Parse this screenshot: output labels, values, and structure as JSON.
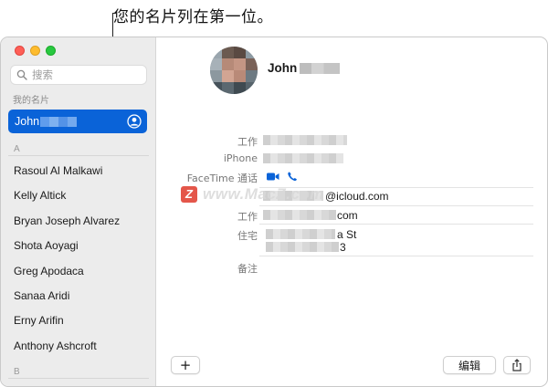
{
  "callout": {
    "text": "您的名片列在第一位。"
  },
  "window": {
    "traffic_lights": {
      "close": "#fe5f57",
      "minimize": "#febc2e",
      "zoom": "#28c840"
    }
  },
  "sidebar": {
    "search": {
      "placeholder": "搜索",
      "value": ""
    },
    "my_card_header": "我的名片",
    "my_card": {
      "name": "John",
      "accent": "#0a63d8",
      "icon": "me-badge-icon"
    },
    "sections": [
      {
        "letter": "A",
        "contacts": [
          "Rasoul Al Malkawi",
          "Kelly Altick",
          "Bryan Joseph Alvarez",
          "Shota Aoyagi",
          "Greg Apodaca",
          "Sanaa Aridi",
          "Erny Arifin",
          "Anthony Ashcroft"
        ]
      },
      {
        "letter": "B",
        "contacts": []
      }
    ]
  },
  "detail": {
    "name": "John",
    "fields": [
      {
        "label": "工作"
      },
      {
        "label": "iPhone"
      },
      {
        "label": "FaceTime 通话",
        "icons": [
          "video-camera-icon",
          "phone-icon"
        ]
      },
      {
        "label": "",
        "value": "@icloud.com"
      },
      {
        "label": "工作",
        "value": "com"
      },
      {
        "label": "住宅",
        "value_line1": "a St",
        "value_line2": "3"
      },
      {
        "label": "备注"
      }
    ],
    "facetime_color": "#0a63d8"
  },
  "watermark": {
    "logo": "Z",
    "text": "www.MacZ.com"
  },
  "footer": {
    "add_label": "+",
    "edit_label": "编辑",
    "share_icon": "share-icon"
  }
}
